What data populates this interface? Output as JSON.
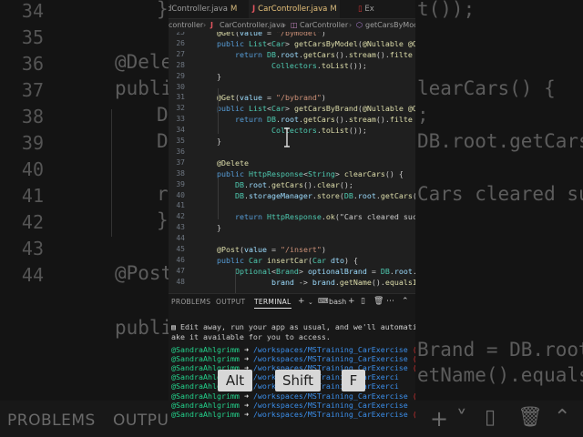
{
  "background": {
    "line_numbers": [
      "34",
      "35",
      "36",
      "37",
      "38",
      "39",
      "40",
      "41",
      "42",
      "43",
      "44"
    ],
    "code_left": [
      "}",
      "",
      "@Dele",
      "publi",
      "D",
      "D",
      "",
      "r",
      "}",
      "",
      "@Post"
    ],
    "code_right": [
      "t());",
      "",
      "",
      "learCars() {",
      ";",
      "DB.root.getCars(",
      "",
      "Cars cleared suc",
      "",
      "",
      ""
    ],
    "line_extra": [
      "publi",
      "Brand = DB.root.",
      "etName().equalsI"
    ],
    "panel_tabs": [
      "PROBLEMS",
      "OUTPUT"
    ],
    "top_fragment": "dController.java M"
  },
  "tabs": [
    {
      "label": "dController.java",
      "modified": "M",
      "active": false
    },
    {
      "label": "CarController.java",
      "modified": "M",
      "active": true,
      "icon": "J"
    },
    {
      "label": "Ex",
      "active": false
    }
  ],
  "breadcrumb": [
    "controller",
    "CarController.java",
    "CarController",
    "getCarsByMod"
  ],
  "editor": {
    "lines": [
      {
        "n": "25",
        "text": "@Get(value = \"/bymodel\")"
      },
      {
        "n": "26",
        "text": "public List<Car> getCarsByModel(@Nullable @Q"
      },
      {
        "n": "27",
        "text": "    return DB.root.getCars().stream().filte"
      },
      {
        "n": "28",
        "text": "            Collectors.toList());"
      },
      {
        "n": "29",
        "text": "}"
      },
      {
        "n": "30",
        "text": ""
      },
      {
        "n": "31",
        "text": "@Get(value = \"/bybrand\")"
      },
      {
        "n": "32",
        "text": "public List<Car> getCarsByBrand(@Nullable @Q"
      },
      {
        "n": "33",
        "text": "    return DB.root.getCars().stream().filte"
      },
      {
        "n": "34",
        "text": "            Collectors.toList());"
      },
      {
        "n": "35",
        "text": "}"
      },
      {
        "n": "36",
        "text": ""
      },
      {
        "n": "37",
        "text": "@Delete"
      },
      {
        "n": "38",
        "text": "public HttpResponse<String> clearCars() {"
      },
      {
        "n": "39",
        "text": "    DB.root.getCars().clear();"
      },
      {
        "n": "40",
        "text": "    DB.storageManager.store(DB.root.getCars("
      },
      {
        "n": "41",
        "text": ""
      },
      {
        "n": "42",
        "text": "    return HttpResponse.ok(\"Cars cleared succ"
      },
      {
        "n": "43",
        "text": "}"
      },
      {
        "n": "44",
        "text": ""
      },
      {
        "n": "45",
        "text": "@Post(value = \"/insert\")"
      },
      {
        "n": "46",
        "text": "public Car insertCar(Car dto) {"
      },
      {
        "n": "47",
        "text": "    Optional<Brand> optionalBrand = DB.root."
      },
      {
        "n": "48",
        "text": "            brand -> brand.getName().equalsIg"
      }
    ]
  },
  "panel": {
    "tabs": [
      "PROBLEMS",
      "OUTPUT",
      "TERMINAL"
    ],
    "active_tab": "TERMINAL",
    "shell_label": "bash",
    "notice_line1": "Edit away, run your app as usual, and we'll automatica",
    "notice_line2": "ake it available for you to access.",
    "prompts": [
      {
        "user": "@SandraAhlgrimm",
        "path": "/workspaces/MSTraining_CarExercise",
        "branch": "(ma"
      },
      {
        "user": "@SandraAhlgrimm",
        "path": "/workspaces/MSTraining_CarExercise",
        "branch": "("
      },
      {
        "user": "@SandraAhlgrimm",
        "path": "/workspaces/MSTraining_CarExercise",
        "branch": "(mas"
      },
      {
        "user": "@SandraAhlgrimm",
        "path": "/workspaces/MSTraining_CarExerci",
        "branch": ""
      },
      {
        "user": "@SandraAhlgrimm",
        "path": "/workspaces/MSTraining_CarExerci",
        "branch": ""
      },
      {
        "user": "@SandraAhlgrimm",
        "path": "/workspaces/MSTraining_CarExercise",
        "branch": "(mas"
      },
      {
        "user": "@SandraAhlgrimm",
        "path": "/workspaces/MSTraining_CarExercise",
        "branch": ""
      },
      {
        "user": "@SandraAhlgrimm",
        "path": "/workspaces/MSTraining_CarExercise",
        "branch": "(mas"
      }
    ]
  },
  "keys": [
    "Alt",
    "Shift",
    "F"
  ],
  "colors": {
    "accent_tab": "#e8c27a",
    "keyword": "#569cd6",
    "type": "#4ec9b0",
    "string": "#ce9178",
    "term_user": "#23d18b",
    "term_path": "#3b8eea"
  }
}
